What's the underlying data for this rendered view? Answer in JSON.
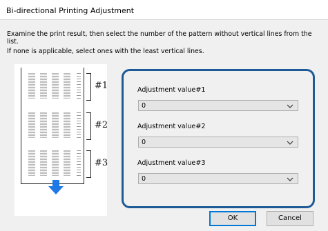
{
  "window": {
    "title": "Bi-directional Printing Adjustment"
  },
  "instructions": {
    "line1": "Examine the print result, then select the number of the pattern without vertical lines from the",
    "line2": "list.",
    "line3": "If none is applicable, select ones with the least vertical lines."
  },
  "pattern_image": {
    "groups": [
      "#1",
      "#2",
      "#3"
    ]
  },
  "fields": [
    {
      "label": "Adjustment value#1",
      "value": "0"
    },
    {
      "label": "Adjustment value#2",
      "value": "0"
    },
    {
      "label": "Adjustment value#3",
      "value": "0"
    }
  ],
  "buttons": {
    "ok": "OK",
    "cancel": "Cancel"
  },
  "colors": {
    "accent_border": "#1d5a96",
    "arrow": "#1e78e6",
    "ok_focus": "#0078d7"
  }
}
